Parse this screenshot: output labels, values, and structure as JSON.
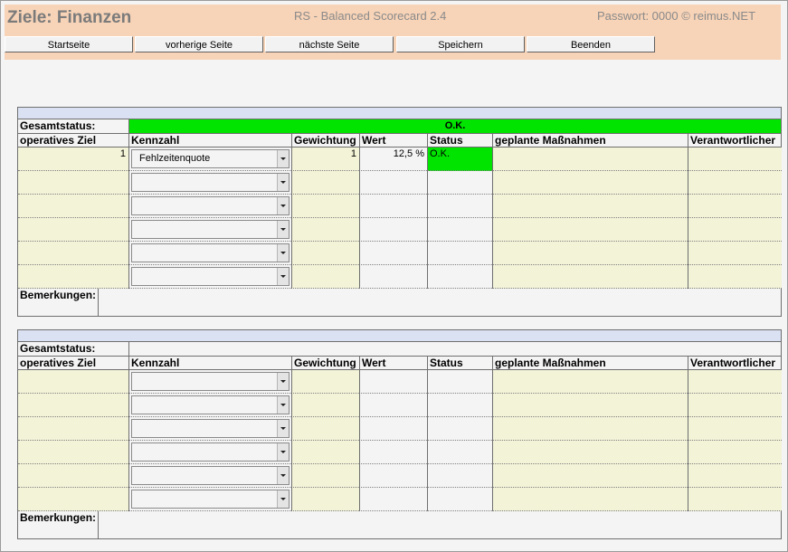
{
  "header": {
    "title": "Ziele: Finanzen",
    "app_name": "RS - Balanced Scorecard 2.4",
    "password_info": "Passwort: 0000 © reimus.NET"
  },
  "toolbar": {
    "buttons": [
      "Startseite",
      "vorherige Seite",
      "nächste Seite",
      "Speichern",
      "Beenden"
    ]
  },
  "labels": {
    "overall_status": "Gesamtstatus:",
    "columns": [
      "operatives Ziel",
      "Kennzahl",
      "Gewichtung",
      "Wert",
      "Status",
      "geplante Maßnahmen",
      "Verantwortlicher"
    ],
    "remarks": "Bemerkungen:"
  },
  "sections": [
    {
      "overall_status": "O.K.",
      "rows": [
        {
          "goal": "1",
          "metric": "Fehlzeitenquote",
          "weight": "1",
          "value": "12,5 %",
          "status": "O.K.",
          "measures": "",
          "owner": ""
        },
        {
          "goal": "",
          "metric": "",
          "weight": "",
          "value": "",
          "status": "",
          "measures": "",
          "owner": ""
        },
        {
          "goal": "",
          "metric": "",
          "weight": "",
          "value": "",
          "status": "",
          "measures": "",
          "owner": ""
        },
        {
          "goal": "",
          "metric": "",
          "weight": "",
          "value": "",
          "status": "",
          "measures": "",
          "owner": ""
        },
        {
          "goal": "",
          "metric": "",
          "weight": "",
          "value": "",
          "status": "",
          "measures": "",
          "owner": ""
        },
        {
          "goal": "",
          "metric": "",
          "weight": "",
          "value": "",
          "status": "",
          "measures": "",
          "owner": ""
        }
      ],
      "remarks": ""
    },
    {
      "overall_status": "",
      "rows": [
        {
          "goal": "",
          "metric": "",
          "weight": "",
          "value": "",
          "status": "",
          "measures": "",
          "owner": ""
        },
        {
          "goal": "",
          "metric": "",
          "weight": "",
          "value": "",
          "status": "",
          "measures": "",
          "owner": ""
        },
        {
          "goal": "",
          "metric": "",
          "weight": "",
          "value": "",
          "status": "",
          "measures": "",
          "owner": ""
        },
        {
          "goal": "",
          "metric": "",
          "weight": "",
          "value": "",
          "status": "",
          "measures": "",
          "owner": ""
        },
        {
          "goal": "",
          "metric": "",
          "weight": "",
          "value": "",
          "status": "",
          "measures": "",
          "owner": ""
        },
        {
          "goal": "",
          "metric": "",
          "weight": "",
          "value": "",
          "status": "",
          "measures": "",
          "owner": ""
        }
      ],
      "remarks": ""
    }
  ],
  "colors": {
    "header_bg": "#f7d3b7",
    "status_ok": "#00e400",
    "input_cell": "#f3f3d8",
    "section_band": "#d9e1f2"
  }
}
